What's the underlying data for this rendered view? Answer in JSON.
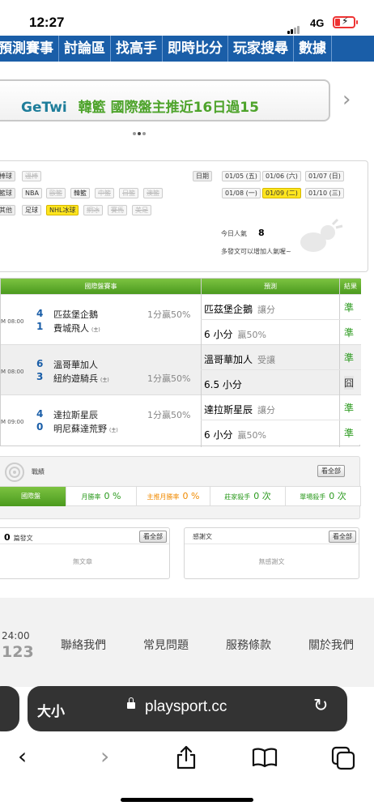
{
  "status_bar": {
    "time": "12:27",
    "network": "4G"
  },
  "nav": {
    "items": [
      "預測賽事",
      "討論區",
      "找高手",
      "即時比分",
      "玩家搜尋",
      "數據"
    ]
  },
  "banner": {
    "brand": "GeTwi",
    "text": "韓籃 國際盤主推近16日過15"
  },
  "filter": {
    "rows": [
      {
        "label": "棒球",
        "tags": [
          {
            "text": "溫棒",
            "state": "disabled"
          }
        ]
      },
      {
        "label": "籃球",
        "tags": [
          {
            "text": "NBA",
            "state": "normal"
          },
          {
            "text": "歐籃",
            "state": "disabled"
          },
          {
            "text": "韓籃",
            "state": "normal"
          },
          {
            "text": "中籃",
            "state": "disabled"
          },
          {
            "text": "日籃",
            "state": "disabled"
          },
          {
            "text": "澳籃",
            "state": "disabled"
          }
        ]
      },
      {
        "label": "其他",
        "tags": [
          {
            "text": "足球",
            "state": "normal"
          },
          {
            "text": "NHL冰球",
            "state": "selected"
          },
          {
            "text": "網冰",
            "state": "disabled"
          },
          {
            "text": "賽馬",
            "state": "disabled"
          },
          {
            "text": "美足",
            "state": "disabled"
          }
        ]
      }
    ],
    "date_label": "日期",
    "dates": [
      {
        "text": "01/05 (五)",
        "state": "normal"
      },
      {
        "text": "01/06 (六)",
        "state": "normal"
      },
      {
        "text": "01/07 (日)",
        "state": "normal"
      },
      {
        "text": "01/08 (一)",
        "state": "normal"
      },
      {
        "text": "01/09 (二)",
        "state": "selected"
      },
      {
        "text": "01/10 (三)",
        "state": "normal"
      }
    ],
    "popularity_label": "今日人氣",
    "popularity_value": "8",
    "promo_text": "多發文可以增加人氣喔~"
  },
  "games_table": {
    "headers": {
      "match": "國際盤賽事",
      "prediction": "預測",
      "result": "結果"
    },
    "games": [
      {
        "time": "M 08:00",
        "away": {
          "score": "4",
          "team": "匹茲堡企鵝",
          "host": ""
        },
        "home": {
          "score": "1",
          "team": "費城飛人",
          "host": "(主)"
        },
        "line_top": "1分贏50%",
        "line_bottom": "",
        "pred1": {
          "text": "匹茲堡企鵝",
          "note": "讓分",
          "result": "準",
          "miss": false
        },
        "pred2": {
          "text": "6 小分",
          "note": "贏50%",
          "result": "準",
          "miss": false
        },
        "shaded": false
      },
      {
        "time": "M 08:00",
        "away": {
          "score": "6",
          "team": "溫哥華加人",
          "host": ""
        },
        "home": {
          "score": "3",
          "team": "紐約遊騎兵",
          "host": "(主)"
        },
        "line_top": "",
        "line_bottom": "1分贏50%",
        "pred1": {
          "text": "溫哥華加人",
          "note": "受讓",
          "result": "準",
          "miss": false
        },
        "pred2": {
          "text": "6.5 小分",
          "note": "",
          "result": "囧",
          "miss": true
        },
        "shaded": true
      },
      {
        "time": "M 09:00",
        "away": {
          "score": "4",
          "team": "達拉斯星辰",
          "host": ""
        },
        "home": {
          "score": "0",
          "team": "明尼蘇達荒野",
          "host": "(主)"
        },
        "line_top": "1分贏50%",
        "line_bottom": "",
        "pred1": {
          "text": "達拉斯星辰",
          "note": "讓分",
          "result": "準",
          "miss": false
        },
        "pred2": {
          "text": "6 小分",
          "note": "贏50%",
          "result": "準",
          "miss": false
        },
        "shaded": false
      }
    ]
  },
  "record": {
    "title": "戰績",
    "more": "看全部",
    "tabs": [
      {
        "label": "國際盤",
        "value": "",
        "active": true
      },
      {
        "label": "月勝率",
        "value": "0 %",
        "color": "#2b9a1e"
      },
      {
        "label": "主推月勝率",
        "value": "0 %",
        "color": "#f08a00"
      },
      {
        "label": "莊家殺手",
        "value": "0 次",
        "color": "#2b9a1e"
      },
      {
        "label": "單場殺手",
        "value": "0 次",
        "color": "#2b9a1e"
      }
    ]
  },
  "articles": {
    "count": "0",
    "label": "篇發文",
    "more": "看全部",
    "empty": "無文章"
  },
  "thanks": {
    "label": "感謝文",
    "more": "看全部",
    "empty": "無感謝文"
  },
  "footer": {
    "hours": "24:00",
    "phone": "123",
    "links": [
      "聯絡我們",
      "常見問題",
      "服務條款",
      "關於我們"
    ]
  },
  "browser": {
    "text_size": "大小",
    "url": "playsport.cc"
  }
}
